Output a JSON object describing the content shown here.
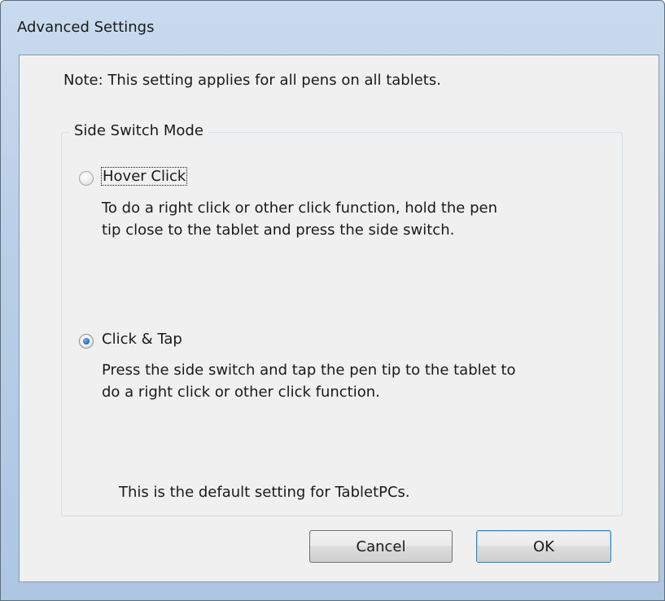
{
  "window": {
    "title": "Advanced Settings"
  },
  "dialog": {
    "note": "Note: This setting applies for all pens on all tablets.",
    "group_label": "Side Switch Mode",
    "options": [
      {
        "label": "Hover Click",
        "selected": false,
        "focused": true,
        "description_lines": [
          "To do a right click or other click function, hold the pen",
          "tip close to the tablet and press the side switch."
        ]
      },
      {
        "label": "Click & Tap",
        "selected": true,
        "focused": false,
        "description_lines": [
          "Press the side switch and tap the pen tip to the tablet to",
          "do a right click or other click function."
        ]
      }
    ],
    "default_note": "This is the default setting for TabletPCs.",
    "buttons": {
      "cancel": "Cancel",
      "ok": "OK"
    }
  },
  "colors": {
    "window_frame": "#b9cfe7",
    "client_background": "#f0f0f0",
    "radio_selected": "#2b73c8",
    "default_button_border": "#3c7fb1"
  }
}
